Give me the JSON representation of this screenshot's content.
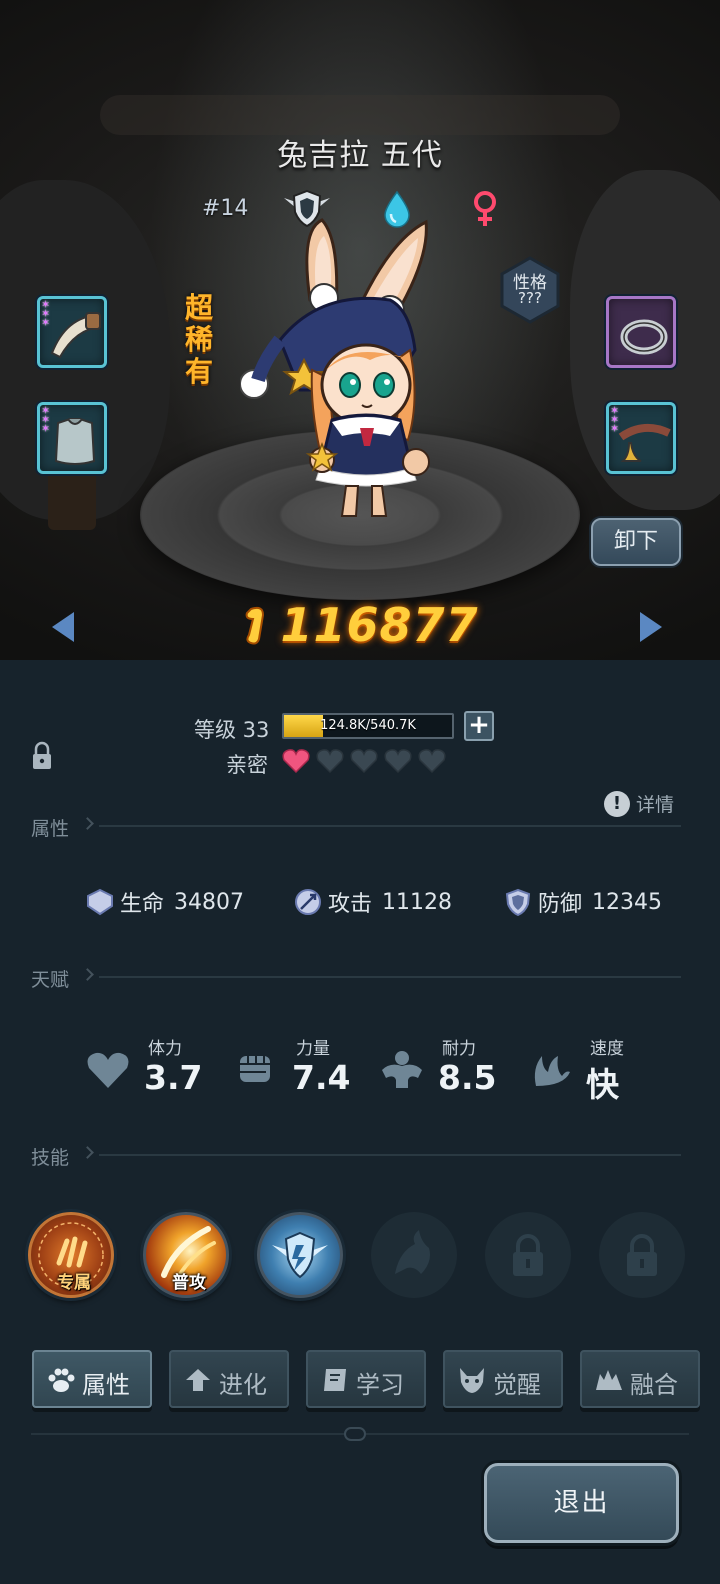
{
  "character": {
    "name": "兔吉拉 五代",
    "id": "#14",
    "rarity": "超稀有",
    "personality_label": "性格",
    "personality_value": "???",
    "power": "116877"
  },
  "equipment": {
    "unequip_label": "卸下"
  },
  "stats": {
    "level_label": "等级 33",
    "exp_text": "124.8K/540.7K",
    "exp_fraction": 0.23,
    "intimacy_label": "亲密",
    "intimacy_filled": 1,
    "intimacy_total": 5,
    "detail_label": "详情"
  },
  "sections": {
    "attributes": "属性",
    "talent": "天赋",
    "skills": "技能"
  },
  "attributes": [
    {
      "name": "生命",
      "value": "34807",
      "icon": "life-icon"
    },
    {
      "name": "攻击",
      "value": "11128",
      "icon": "attack-icon"
    },
    {
      "name": "防御",
      "value": "12345",
      "icon": "defense-icon"
    }
  ],
  "talents": [
    {
      "label": "体力",
      "value": "3.7",
      "icon": "heart-icon"
    },
    {
      "label": "力量",
      "value": "7.4",
      "icon": "fist-icon"
    },
    {
      "label": "耐力",
      "value": "8.5",
      "icon": "muscle-icon"
    },
    {
      "label": "速度",
      "value": "快",
      "icon": "wing-icon"
    }
  ],
  "skills": [
    {
      "label": "专属",
      "state": "active"
    },
    {
      "label": "普攻",
      "state": "active"
    },
    {
      "label": "",
      "state": "active"
    },
    {
      "label": "",
      "state": "locked-preview"
    },
    {
      "label": "",
      "state": "locked"
    },
    {
      "label": "",
      "state": "locked"
    }
  ],
  "tabs": [
    {
      "label": "属性",
      "icon": "paw-icon",
      "active": true
    },
    {
      "label": "进化",
      "icon": "arrow-up-icon",
      "active": false
    },
    {
      "label": "学习",
      "icon": "book-icon",
      "active": false
    },
    {
      "label": "觉醒",
      "icon": "wolf-icon",
      "active": false
    },
    {
      "label": "融合",
      "icon": "fusion-icon",
      "active": false
    }
  ],
  "exit_label": "退出",
  "colors": {
    "accent_gold": "#ffce3c",
    "rarity_orange": "#ffb52a",
    "heart_pink": "#f0557f",
    "panel_bg": "#17232c"
  }
}
